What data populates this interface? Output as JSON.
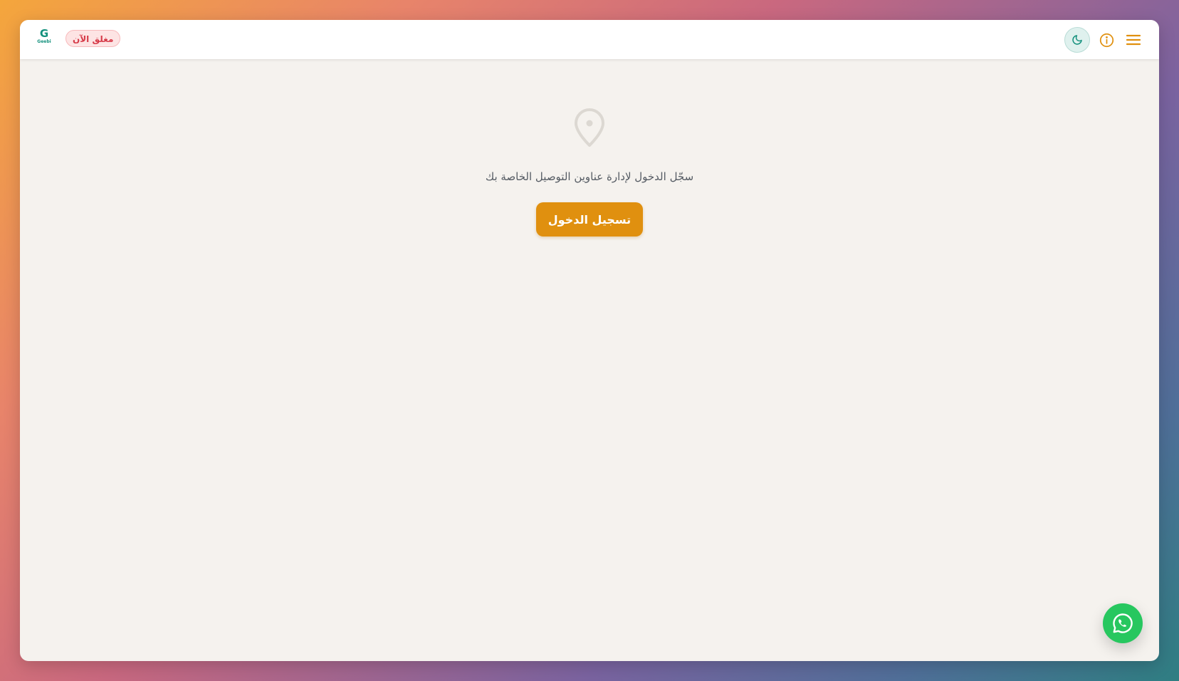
{
  "header": {
    "logo": {
      "mark": "G",
      "wordmark": "Geebi",
      "tagline": "Geebi"
    },
    "status_badge": "مغلق الآن",
    "icons": {
      "theme_toggle": "moon-icon",
      "info": "info-icon",
      "menu": "hamburger-menu-icon"
    }
  },
  "main": {
    "icon": "map-pin-icon",
    "message": "سجّل الدخول لإدارة عناوين التوصيل الخاصة بك",
    "login_button": "تسجيل الدخول"
  },
  "floating": {
    "whatsapp_icon": "whatsapp-icon"
  },
  "colors": {
    "accent": "#e0900f",
    "brand": "#12907c",
    "closed_badge_text": "#d63a48",
    "closed_badge_bg": "#fde4e4",
    "whatsapp": "#27c75f",
    "page_background": "#f5f2ee"
  }
}
